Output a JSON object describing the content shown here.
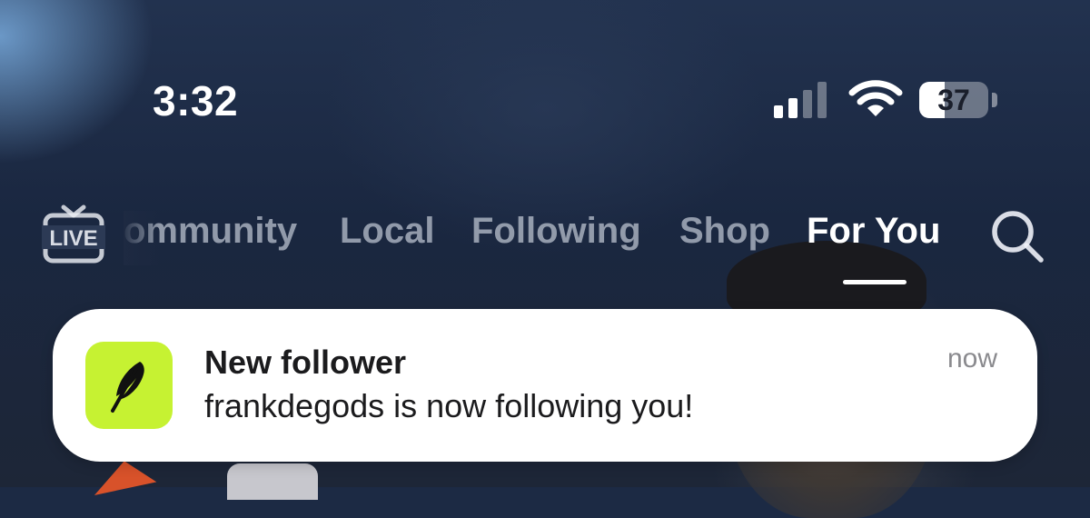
{
  "status_bar": {
    "time": "3:32",
    "battery_percent": "37",
    "battery_level": 0.37,
    "signal_bars_active": 2,
    "signal_bars_total": 4
  },
  "nav": {
    "live_label": "LIVE",
    "tabs": [
      {
        "label": "Community",
        "visible_text": "ommunity",
        "active": false
      },
      {
        "label": "Local",
        "active": false
      },
      {
        "label": "Following",
        "active": false
      },
      {
        "label": "Shop",
        "active": false
      },
      {
        "label": "For You",
        "active": true
      }
    ]
  },
  "notification": {
    "app_icon": "feather-icon",
    "app_icon_color": "#c6f232",
    "title": "New follower",
    "body": "frankdegods is now following you!",
    "time": "now"
  },
  "colors": {
    "background": "#1c2a44",
    "active_tab": "#ffffff",
    "inactive_tab": "rgba(220,226,236,0.62)"
  }
}
